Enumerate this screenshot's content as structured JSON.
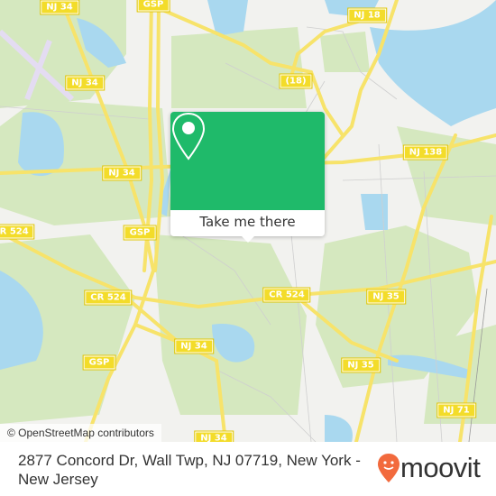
{
  "map": {
    "attribution": "© OpenStreetMap contributors",
    "colors": {
      "land": "#f2f2ef",
      "park": "#d5e8bf",
      "water": "#a9d8ef",
      "road": "#f7e36a",
      "shield": "#f3dc2a",
      "runway": "#e4dcf2"
    },
    "road_labels": [
      "NJ 34",
      "NJ 34",
      "NJ 34",
      "GSP",
      "GSP",
      "GSP",
      "NJ 18",
      "(18)",
      "NJ 138",
      "CR 524",
      "CR 524",
      "CR 524",
      "NJ 35",
      "NJ 35",
      "NJ 34",
      "NJ 34",
      "NJ 71"
    ]
  },
  "popup": {
    "icon": "map-pin-icon",
    "button_label": "Take me there",
    "color": "#1fba6a"
  },
  "footer": {
    "address": "2877 Concord Dr, Wall Twp, NJ 07719, New York - New Jersey",
    "brand": "moovit",
    "brand_color": "#f26a3d"
  }
}
